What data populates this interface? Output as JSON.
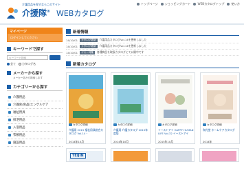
{
  "header": {
    "tagline": "介護用品を探すならこのサイト",
    "brand": "介援隊",
    "brand_mark": "®",
    "web_title": "WEBカタログ",
    "nav": [
      "トップページ",
      "ショッピングカート",
      "WEBカタログトップ",
      "使い方"
    ]
  },
  "sidebar": {
    "mypage_title": "マイページ",
    "mypage_body": "ログインしてください",
    "keyword_title": "キーワードで探す",
    "search_placeholder": "キーワード検索",
    "radio_all": "全て",
    "radio_catalog": "カタログ名",
    "maker_title": "メーカーから探す",
    "maker_sub": "メーカー名から検索します",
    "category_title": "カテゴリーから探す",
    "categories": [
      "介護用品",
      "介護食/食品/エンゲルケア",
      "福祉用具",
      "排泄用品",
      "入浴用品",
      "衣類用品",
      "施設用品"
    ]
  },
  "news": {
    "title": "新着情報",
    "items": [
      {
        "date": "14/10/01",
        "tag": "カタログ更新",
        "text": "介護用品カタログVol.14を更新しました"
      },
      {
        "date": "14/10/01",
        "tag": "カタログ更新",
        "text": "介護用品カタログVol.14を更新しました"
      },
      {
        "date": "14/10/01",
        "tag": "ゲスト特集",
        "text": "各種商品を取扱カタログにて公開中です"
      }
    ]
  },
  "catalog": {
    "title": "新着カタログ",
    "badge": "カタログ詳細",
    "items": [
      {
        "title": "介護用 2015 福祉用具総合カタログ Vol.14・",
        "date": "2014年10月"
      },
      {
        "title": "介護用 介護カタログ 2015年度版",
        "date": "2014年10月"
      },
      {
        "title": "イーストアイ HAPPY HUMAN LIFE Vol.32 イーストアイ",
        "date": "2015年10月"
      },
      {
        "title": "和光堂 ホームケアカタログ",
        "date": "2014年"
      }
    ],
    "second_row_logo": "TEIJIN"
  },
  "colors": {
    "brand_blue": "#1b5fa8",
    "accent_orange": "#f08419"
  }
}
